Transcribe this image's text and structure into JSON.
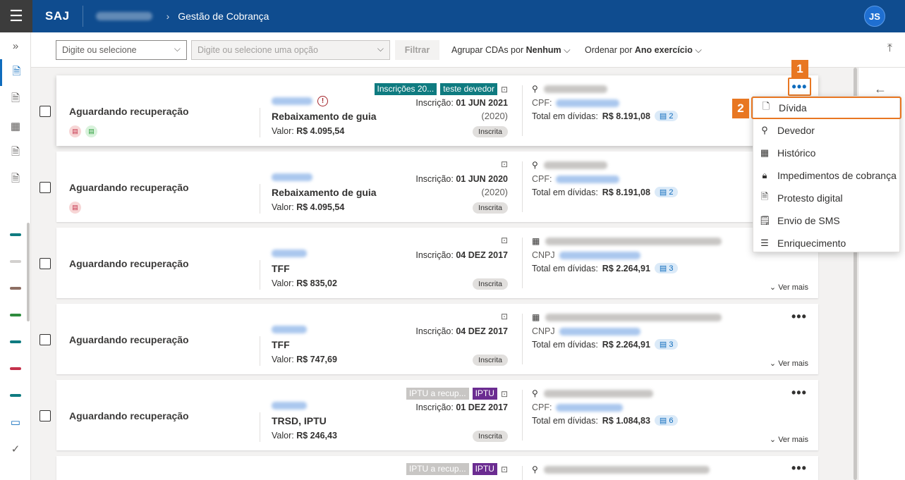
{
  "header": {
    "brand": "SAJ",
    "breadcrumb": "Gestão de Cobrança",
    "user_initials": "JS"
  },
  "toolbar": {
    "combo1_placeholder": "Digite ou selecione",
    "combo2_placeholder": "Digite ou selecione uma opção",
    "filter_label": "Filtrar",
    "group_label": "Agrupar CDAs por",
    "group_value": "Nenhum",
    "order_label": "Ordenar por",
    "order_value": "Ano exercício"
  },
  "cards": [
    {
      "status": "Aguardando recuperação",
      "title": "Rebaixamento de guia",
      "valor_label": "Valor:",
      "valor": "R$ 4.095,54",
      "tags": [
        "Inscrições 20...",
        "teste devedor"
      ],
      "inscricao_label": "Inscrição:",
      "inscricao": "01 JUN 2021",
      "year": "(2020)",
      "pill": "Inscrita",
      "doc_label": "CPF:",
      "total_label": "Total em dívidas:",
      "total": "R$ 8.191,08",
      "count": "2"
    },
    {
      "status": "Aguardando recuperação",
      "title": "Rebaixamento de guia",
      "valor_label": "Valor:",
      "valor": "R$ 4.095,54",
      "inscricao_label": "Inscrição:",
      "inscricao": "01 JUN 2020",
      "year": "(2020)",
      "pill": "Inscrita",
      "doc_label": "CPF:",
      "total_label": "Total em dívidas:",
      "total": "R$ 8.191,08",
      "count": "2"
    },
    {
      "status": "Aguardando recuperação",
      "title": "TFF",
      "valor_label": "Valor:",
      "valor": "R$ 835,02",
      "inscricao_label": "Inscrição:",
      "inscricao": "04 DEZ 2017",
      "pill": "Inscrita",
      "doc_label": "CNPJ",
      "total_label": "Total em dívidas:",
      "total": "R$ 2.264,91",
      "count": "3",
      "ver_mais": "Ver mais"
    },
    {
      "status": "Aguardando recuperação",
      "title": "TFF",
      "valor_label": "Valor:",
      "valor": "R$ 747,69",
      "inscricao_label": "Inscrição:",
      "inscricao": "04 DEZ 2017",
      "pill": "Inscrita",
      "doc_label": "CNPJ",
      "total_label": "Total em dívidas:",
      "total": "R$ 2.264,91",
      "count": "3",
      "ver_mais": "Ver mais"
    },
    {
      "status": "Aguardando recuperação",
      "title": "TRSD, IPTU",
      "valor_label": "Valor:",
      "valor": "R$ 246,43",
      "tags": [
        "IPTU a recup...",
        "IPTU"
      ],
      "inscricao_label": "Inscrição:",
      "inscricao": "01 DEZ 2017",
      "pill": "Inscrita",
      "doc_label": "CPF:",
      "total_label": "Total em dívidas:",
      "total": "R$ 1.084,83",
      "count": "6",
      "ver_mais": "Ver mais"
    },
    {
      "tags": [
        "IPTU a recup...",
        "IPTU"
      ]
    }
  ],
  "menu": {
    "items": [
      "Dívida",
      "Devedor",
      "Histórico",
      "Impedimentos de cobrança",
      "Protesto digital",
      "Envio de SMS",
      "Enriquecimento"
    ]
  },
  "callouts": [
    "1",
    "2"
  ],
  "colors": {
    "header": "#0f4c8f",
    "accent_orange": "#e87722",
    "teal_tag": "#0f7b80",
    "purple_tag": "#6b2c91"
  }
}
